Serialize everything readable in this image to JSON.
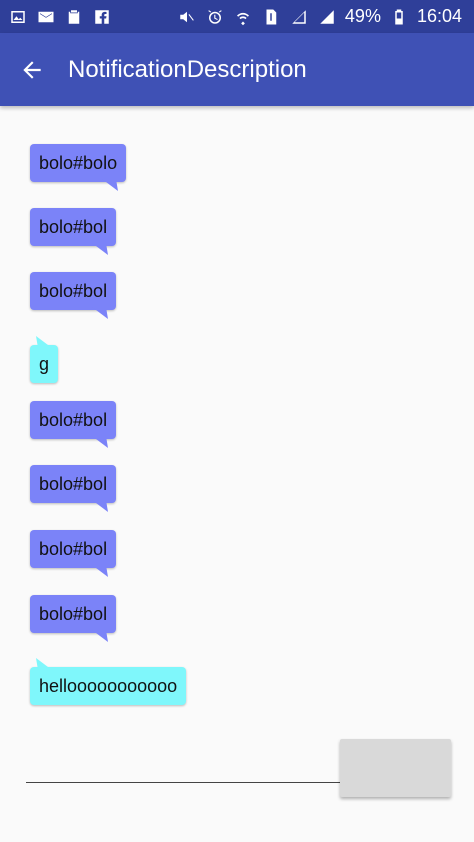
{
  "status_bar": {
    "battery_percent": "49%",
    "time": "16:04"
  },
  "app_bar": {
    "title": "NotificationDescription"
  },
  "messages": [
    {
      "text": "bolo#bolo",
      "type": "sent"
    },
    {
      "text": "bolo#bol",
      "type": "sent"
    },
    {
      "text": "bolo#bol",
      "type": "sent"
    },
    {
      "text": "g",
      "type": "received"
    },
    {
      "text": "bolo#bol",
      "type": "sent"
    },
    {
      "text": "bolo#bol",
      "type": "sent"
    },
    {
      "text": "bolo#bol",
      "type": "sent"
    },
    {
      "text": "bolo#bol",
      "type": "sent"
    },
    {
      "text": "hellooooooooooo",
      "type": "received"
    }
  ],
  "input": {
    "value": ""
  },
  "send_button": {
    "label": ""
  },
  "colors": {
    "status_bar": "#2f3f99",
    "app_bar": "#3f51b5",
    "sent_bubble": "#7b83f8",
    "received_bubble": "#7ff7fb",
    "background": "#fafafa",
    "button": "#d9d9d9"
  }
}
